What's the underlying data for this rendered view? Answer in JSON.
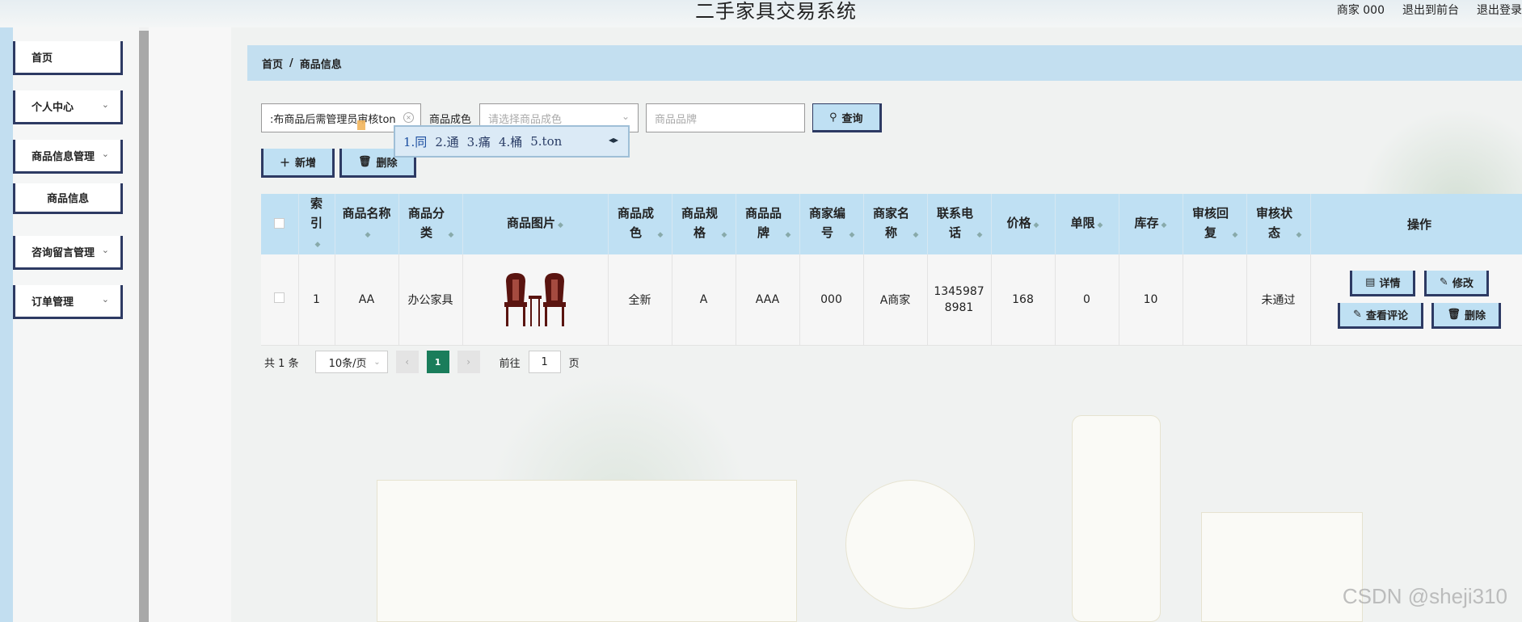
{
  "header": {
    "title": "二手家具交易系统",
    "user": "商家 000",
    "back_to_front": "退出到前台",
    "logout": "退出登录"
  },
  "sidebar": {
    "items": [
      {
        "label": "首页"
      },
      {
        "label": "个人中心"
      },
      {
        "label": "商品信息管理"
      },
      {
        "label": "商品信息"
      },
      {
        "label": "咨询留言管理"
      },
      {
        "label": "订单管理"
      }
    ]
  },
  "breadcrumb": {
    "home": "首页",
    "sep": "/",
    "current": "商品信息"
  },
  "search": {
    "name_value": ":布商品后需管理员审核ton",
    "color_label": "商品成色",
    "color_placeholder": "请选择商品成色",
    "brand_placeholder": "商品品牌",
    "query_label": "查询"
  },
  "ime": {
    "candidates": [
      "1.同",
      "2.通",
      "3.痛",
      "4.桶",
      "5.ton"
    ],
    "arrows": "◂▸"
  },
  "actions": {
    "add_label": "新增",
    "delete_label": "删除"
  },
  "table": {
    "headers": [
      "索引",
      "商品名称",
      "商品分类",
      "商品图片",
      "商品成色",
      "商品规格",
      "商品品牌",
      "商家编号",
      "商家名称",
      "联系电话",
      "价格",
      "单限",
      "库存",
      "审核回复",
      "审核状态",
      "操作"
    ],
    "rows": [
      {
        "index": "1",
        "name": "AA",
        "category": "办公家具",
        "condition": "全新",
        "spec": "A",
        "brand": "AAA",
        "merchant_no": "000",
        "merchant_name": "A商家",
        "phone": "13459878981",
        "price": "168",
        "limit": "0",
        "stock": "10",
        "review_reply": "",
        "review_status": "未通过",
        "ops": {
          "detail": "详情",
          "edit": "修改",
          "comments": "查看评论",
          "delete": "删除"
        }
      }
    ]
  },
  "pager": {
    "total_prefix": "共",
    "total_count": "1",
    "total_suffix": "条",
    "page_size": "10条/页",
    "current_page": "1",
    "goto_label": "前往",
    "goto_value": "1",
    "goto_suffix": "页"
  },
  "watermark": "CSDN @sheji310",
  "colors": {
    "accent": "#bfe0f3",
    "border_dark": "#2d3a63",
    "active_page": "#1a7d5b"
  }
}
